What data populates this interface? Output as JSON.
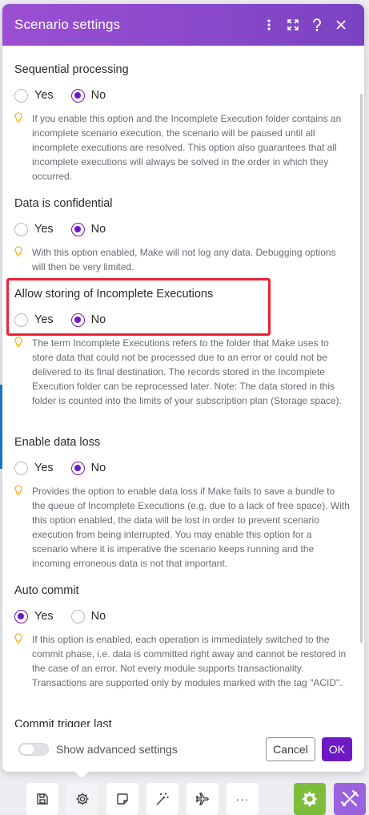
{
  "dialog": {
    "title": "Scenario settings"
  },
  "sections": [
    {
      "title": "Sequential processing",
      "selected": "No",
      "help": "If you enable this option and the Incomplete Execution folder contains an incomplete scenario execution, the scenario will be paused until all incomplete executions are resolved. This option also guarantees that all incomplete executions will always be solved in the order in which they occurred."
    },
    {
      "title": "Data is confidential",
      "selected": "No",
      "help": "With this option enabled, Make will not log any data. Debugging options will then be very limited."
    },
    {
      "title": "Allow storing of Incomplete Executions",
      "selected": "No",
      "help": "The term Incomplete Executions refers to the folder that Make uses to store data that could not be processed due to an error or could not be delivered to its final destination. The records stored in the Incomplete Execution folder can be reprocessed later. Note: The data stored in this folder is counted into the limits of your subscription plan (Storage space)."
    },
    {
      "title": "Enable data loss",
      "selected": "No",
      "help": "Provides the option to enable data loss if Make fails to save a bundle to the queue of Incomplete Executions (e.g. due to a lack of free space). With this option enabled, the data will be lost in order to prevent scenario execution from being interrupted. You may enable this option for a scenario where it is imperative the scenario keeps running and the incoming erroneous data is not that important."
    },
    {
      "title": "Auto commit",
      "selected": "Yes",
      "help": "If this option is enabled, each operation is immediately switched to the commit phase, i.e. data is committed right away and cannot be restored in the case of an error. Not every module supports transactionality. Transactions are supported only by modules marked with the tag \"ACID\"."
    },
    {
      "title": "Commit trigger last"
    }
  ],
  "options": {
    "yes": "Yes",
    "no": "No"
  },
  "footer": {
    "advanced_label": "Show advanced settings",
    "advanced_enabled": false,
    "cancel_label": "Cancel",
    "ok_label": "OK"
  },
  "toolbar": {
    "items": [
      "save-icon",
      "settings-icon",
      "notes-icon",
      "magic-wand-icon",
      "airplane-icon",
      "more-icon"
    ],
    "more_label": "···"
  },
  "colors": {
    "header_start": "#9b4fd3",
    "accent": "#6d19c4",
    "highlight": "#ee2233",
    "green_tool": "#7ebd3c",
    "purple_tool": "#9a62dd"
  }
}
